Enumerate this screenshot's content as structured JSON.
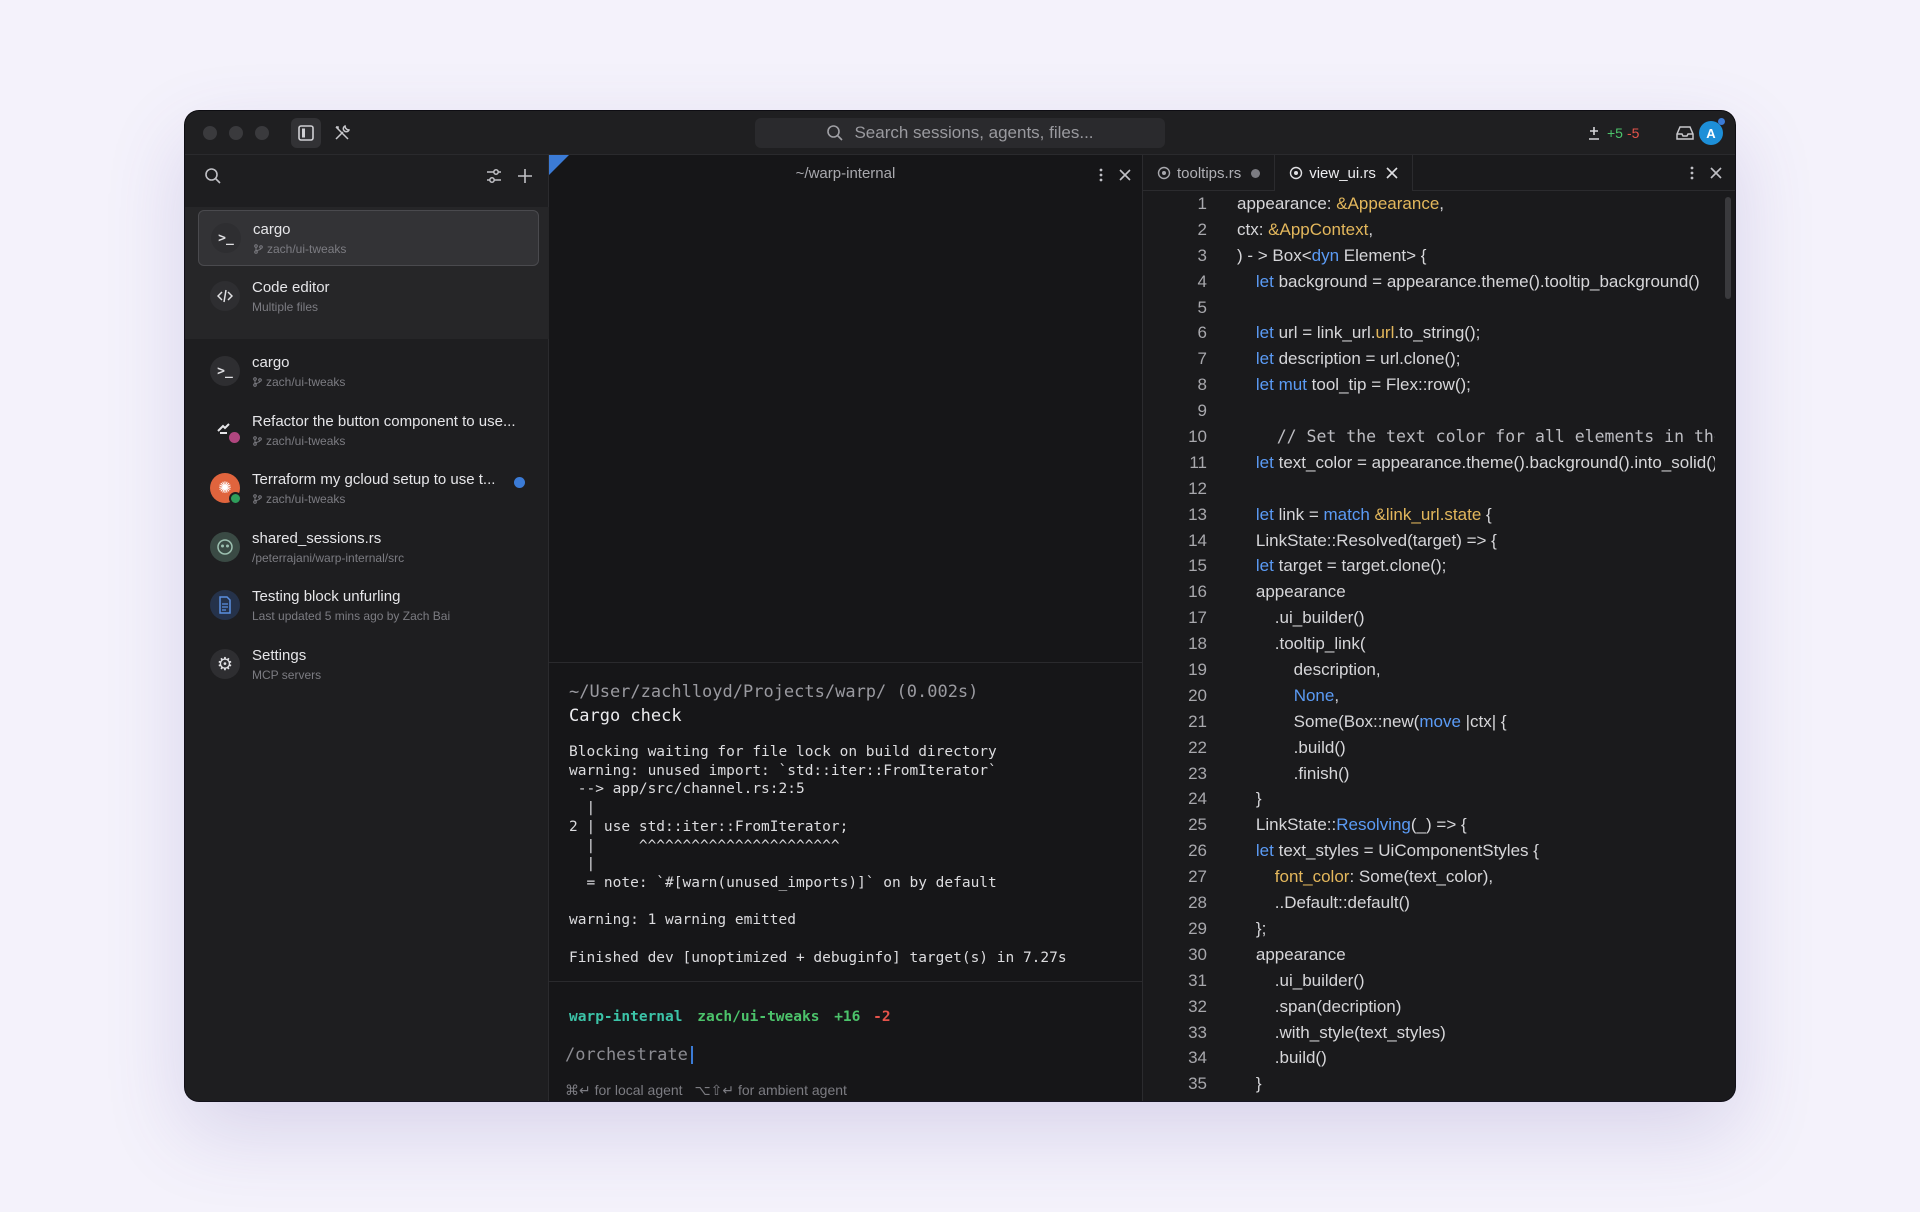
{
  "titlebar": {
    "search_placeholder": "Search sessions, agents, files...",
    "diff_add": "+5",
    "diff_del": "-5",
    "avatar_initial": "A"
  },
  "sidebar": {
    "items": [
      {
        "title": "cargo",
        "subtitle": "zach/ui-tweaks",
        "icon": "terminal-icon",
        "branch": true
      },
      {
        "title": "Code editor",
        "subtitle": "Multiple files",
        "icon": "code-icon",
        "branch": false
      },
      {
        "title": "cargo",
        "subtitle": "zach/ui-tweaks",
        "icon": "terminal-icon",
        "branch": true
      },
      {
        "title": "Refactor the button component to use...",
        "subtitle": "zach/ui-tweaks",
        "icon": "agent-icon",
        "branch": true
      },
      {
        "title": "Terraform my gcloud setup to use t...",
        "subtitle": "zach/ui-tweaks",
        "icon": "claude-agent-icon",
        "branch": true
      },
      {
        "title": "shared_sessions.rs",
        "subtitle": "/peterrajani/warp-internal/src",
        "icon": "shared-session-icon",
        "branch": false
      },
      {
        "title": "Testing block unfurling",
        "subtitle": "Last updated 5 mins ago by Zach Bai",
        "icon": "document-icon",
        "branch": false
      },
      {
        "title": "Settings",
        "subtitle": "MCP servers",
        "icon": "gear-icon",
        "branch": false
      }
    ]
  },
  "terminal": {
    "path": "~/warp-internal",
    "block_path": "~/User/zachlloyd/Projects/warp/ (0.002s)",
    "block_command": "Cargo check",
    "output": "Blocking waiting for file lock on build directory\nwarning: unused import: `std::iter::FromIterator`\n --> app/src/channel.rs:2:5\n  |\n2 | use std::iter::FromIterator;\n  |     ^^^^^^^^^^^^^^^^^^^^^^^\n  |\n  = note: `#[warn(unused_imports)]` on by default\n\nwarning: 1 warning emitted\n\nFinished dev [unoptimized + debuginfo] target(s) in 7.27s",
    "prompt_repo": "warp-internal",
    "prompt_branch": "zach/ui-tweaks",
    "prompt_add": "+16",
    "prompt_del": "-2",
    "input_value": "/orchestrate",
    "hint_local_keys": "⌘↵",
    "hint_local": "for local agent",
    "hint_ambient_keys": "⌥⇧↵",
    "hint_ambient": "for ambient agent"
  },
  "editor": {
    "tabs": [
      {
        "label": "tooltips.rs",
        "modified": true,
        "active": false
      },
      {
        "label": "view_ui.rs",
        "modified": false,
        "active": true
      }
    ],
    "line_numbers": [
      "1",
      "2",
      "3",
      "4",
      "5",
      "6",
      "7",
      "8",
      "9",
      "10",
      "11",
      "12",
      "13",
      "14",
      "15",
      "16",
      "17",
      "18",
      "19",
      "20",
      "21",
      "22",
      "23",
      "24",
      "25",
      "26",
      "27",
      "28",
      "29",
      "30",
      "31",
      "32",
      "33",
      "34",
      "35"
    ]
  },
  "colors": {
    "accent_blue": "#5b9bf5",
    "keyword_gold": "#e3b75c",
    "diff_green": "#4cc36b",
    "diff_red": "#e5534b",
    "prompt_teal": "#3cc4a8"
  }
}
